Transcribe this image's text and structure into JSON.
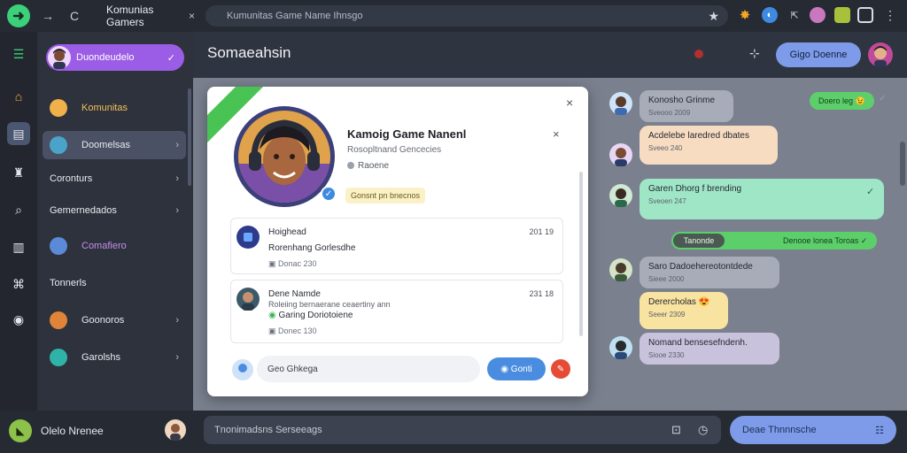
{
  "browser": {
    "tab_title": "Komunias Gamers",
    "tab_close": "×",
    "address": "Kumunitas Game Name Ihnsgo",
    "back": "→",
    "reload": "C",
    "star": "★"
  },
  "rail": {
    "items": [
      "menu-icon",
      "home-icon",
      "chat-icon",
      "games-icon",
      "search-icon",
      "library-icon",
      "store-icon",
      "settings-icon"
    ]
  },
  "sidebar": {
    "me_label": "Duondeudelo",
    "me_check": "✓",
    "items": [
      {
        "label": "Komunitas",
        "chevron": ""
      },
      {
        "label": "Doomelsas",
        "chevron": "›"
      },
      {
        "label": "Coronturs",
        "chevron": "›"
      },
      {
        "label": "Gemernedados",
        "chevron": "›"
      },
      {
        "label": "Comafiero",
        "chevron": ""
      },
      {
        "label": "Tonnerls",
        "chevron": ""
      },
      {
        "label": "Goonoros",
        "chevron": "›"
      },
      {
        "label": "Garolshs",
        "chevron": "›"
      }
    ]
  },
  "header": {
    "title": "Somaeahsin",
    "add_icon": "⊹",
    "button_label": "Gigo Doenne"
  },
  "card": {
    "close": "×",
    "close2": "×",
    "profile_name": "Kamoig Game Nanenl",
    "profile_sub": "Rosopltnand Gencecies",
    "profile_status": "Raoene",
    "profile_tag": "Gonsnt pn bnecnos",
    "verify": "✓",
    "messages": [
      {
        "title": "Hoighead",
        "line2": "Rorenhang Gorlesdhe",
        "meta": "Donac 230",
        "time": "201 19"
      },
      {
        "title": "Dene Namde",
        "line2": "Roleiing bernaerane ceaertiny ann",
        "line3": "Garing Doriotoiene",
        "meta": "Donec 130",
        "time": "231 18"
      }
    ],
    "reply_placeholder": "Geo Ghkega",
    "send_label": "Gonti",
    "red_btn": "✎"
  },
  "chat": {
    "messages": [
      {
        "text": "Konosho Grinme",
        "sub": "Sveooo 2009"
      },
      {
        "text": "Acdelebe laredred dbates",
        "sub": "Sveeo 240"
      },
      {
        "text": "Garen Dhorg f brending",
        "sub": "Sveoen 247"
      },
      {
        "text": "Saro Dadoehereotontdede",
        "sub": "Sieee 2000"
      },
      {
        "text": "Derercholas",
        "sub": "Seeer 2309"
      },
      {
        "text": "Nomand bensesefndenh.",
        "sub": "Siooe 2330"
      }
    ],
    "chip_top": "Doero leg",
    "chip_top_emoji": "😉",
    "chip_top_check": "✓",
    "bubble_check": "✓",
    "divider_left": "Tanonde",
    "divider_right": "Denooe lonea Toroas",
    "divider_check": "✓",
    "emoji_yellow": "😍"
  },
  "bottom": {
    "user_name": "Olelo Nrenee",
    "compose_placeholder": "Tnonimadsns Serseeags",
    "right_search": "Deae Thnnnsche",
    "right_icon": "☷"
  },
  "colors": {
    "accent_purple": "#9b5de5",
    "accent_blue": "#7d9be8",
    "accent_green": "#5ccf6b"
  }
}
